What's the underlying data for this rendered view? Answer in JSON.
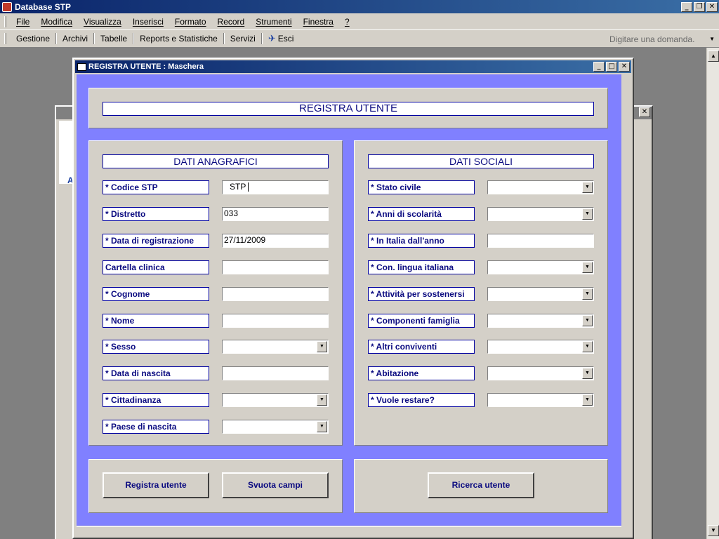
{
  "app": {
    "title": "Database STP"
  },
  "menu": [
    "File",
    "Modifica",
    "Visualizza",
    "Inserisci",
    "Formato",
    "Record",
    "Strumenti",
    "Finestra",
    "?"
  ],
  "toolbar": {
    "items": [
      "Gestione",
      "Archivi",
      "Tabelle",
      "Reports e Statistiche",
      "Servizi"
    ],
    "exit_label": "Esci",
    "help_placeholder": "Digitare una domanda."
  },
  "bg_window": {
    "letter": "A"
  },
  "form": {
    "window_title": "REGISTRA UTENTE : Maschera",
    "header": "REGISTRA UTENTE",
    "anagrafici": {
      "title": "DATI ANAGRAFICI",
      "fields": [
        {
          "label": "* Codice STP",
          "type": "text",
          "value": "STP"
        },
        {
          "label": "* Distretto",
          "type": "text",
          "value": "033"
        },
        {
          "label": "* Data di registrazione",
          "type": "text",
          "value": "27/11/2009"
        },
        {
          "label": "Cartella clinica",
          "type": "text",
          "value": ""
        },
        {
          "label": "* Cognome",
          "type": "text",
          "value": ""
        },
        {
          "label": "* Nome",
          "type": "text",
          "value": ""
        },
        {
          "label": "* Sesso",
          "type": "combo",
          "value": ""
        },
        {
          "label": "* Data di nascita",
          "type": "text",
          "value": ""
        },
        {
          "label": "* Cittadinanza",
          "type": "combo",
          "value": ""
        },
        {
          "label": "* Paese di nascita",
          "type": "combo",
          "value": ""
        }
      ]
    },
    "sociali": {
      "title": "DATI SOCIALI",
      "fields": [
        {
          "label": "* Stato civile",
          "type": "combo",
          "value": ""
        },
        {
          "label": "* Anni di scolarità",
          "type": "combo",
          "value": ""
        },
        {
          "label": "* In Italia dall'anno",
          "type": "text",
          "value": ""
        },
        {
          "label": "* Con. lingua italiana",
          "type": "combo",
          "value": ""
        },
        {
          "label": "* Attività per sostenersi",
          "type": "combo",
          "value": ""
        },
        {
          "label": "* Componenti famiglia",
          "type": "combo",
          "value": ""
        },
        {
          "label": "* Altri conviventi",
          "type": "combo",
          "value": ""
        },
        {
          "label": "* Abitazione",
          "type": "combo",
          "value": ""
        },
        {
          "label": "* Vuole restare?",
          "type": "combo",
          "value": ""
        }
      ]
    },
    "buttons": {
      "register": "Registra utente",
      "clear": "Svuota campi",
      "search": "Ricerca utente"
    }
  }
}
